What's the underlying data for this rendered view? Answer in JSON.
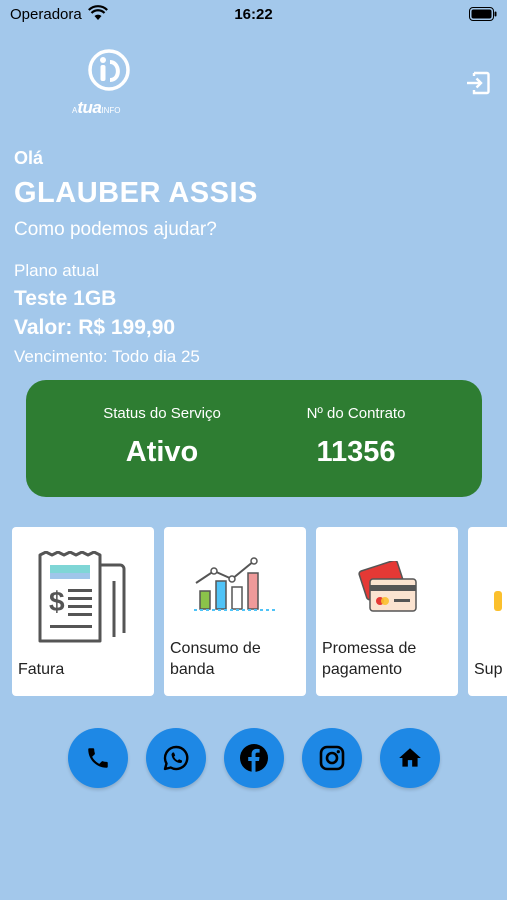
{
  "status_bar": {
    "carrier": "Operadora",
    "time": "16:22"
  },
  "logo": {
    "prefix": "A",
    "main": "tua",
    "suffix": "INFO"
  },
  "header": {
    "greeting": "Olá",
    "user_name": "GLAUBER ASSIS",
    "help_text": "Como podemos ajudar?"
  },
  "plan": {
    "label": "Plano atual",
    "name": "Teste 1GB",
    "value": "Valor: R$ 199,90",
    "due": "Vencimento: Todo dia 25"
  },
  "service": {
    "status_label": "Status do Serviço",
    "status_value": "Ativo",
    "contract_label": "Nº do Contrato",
    "contract_value": "11356",
    "color": "#2e7d32"
  },
  "tiles": [
    {
      "label": "Fatura",
      "icon": "invoice-icon"
    },
    {
      "label": "Consumo de banda",
      "icon": "bandwidth-chart-icon"
    },
    {
      "label": "Promessa de pagamento",
      "icon": "credit-card-icon"
    },
    {
      "label": "Sup",
      "icon": "support-icon"
    }
  ],
  "social": [
    {
      "name": "phone-icon"
    },
    {
      "name": "whatsapp-icon"
    },
    {
      "name": "facebook-icon"
    },
    {
      "name": "instagram-icon"
    },
    {
      "name": "home-icon"
    }
  ],
  "colors": {
    "background": "#a3c8eb",
    "accent": "#1e88e5"
  }
}
